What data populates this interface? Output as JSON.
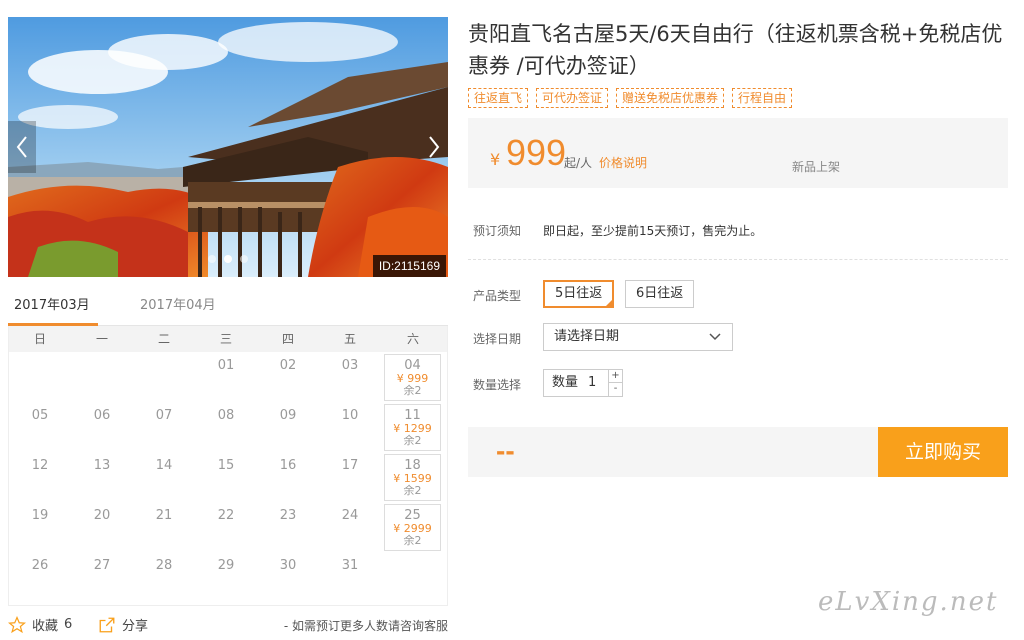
{
  "gallery": {
    "image_id": "ID:2115169",
    "dots": 3,
    "active_dot": 2,
    "image_alt": "Kiyomizu temple wooden stage among red autumn leaves"
  },
  "calendar": {
    "months": [
      "2017年03月",
      "2017年04月"
    ],
    "active_month": 0,
    "weekdays": [
      "日",
      "一",
      "二",
      "三",
      "四",
      "五",
      "六"
    ],
    "weeks": [
      [
        {
          "d": ""
        },
        {
          "d": ""
        },
        {
          "d": ""
        },
        {
          "d": "01"
        },
        {
          "d": "02"
        },
        {
          "d": "03"
        },
        {
          "d": "04",
          "price": "¥ 999",
          "stock": "余2"
        }
      ],
      [
        {
          "d": "05"
        },
        {
          "d": "06"
        },
        {
          "d": "07"
        },
        {
          "d": "08"
        },
        {
          "d": "09"
        },
        {
          "d": "10"
        },
        {
          "d": "11",
          "price": "¥ 1299",
          "stock": "余2"
        }
      ],
      [
        {
          "d": "12"
        },
        {
          "d": "13"
        },
        {
          "d": "14"
        },
        {
          "d": "15"
        },
        {
          "d": "16"
        },
        {
          "d": "17"
        },
        {
          "d": "18",
          "price": "¥ 1599",
          "stock": "余2"
        }
      ],
      [
        {
          "d": "19"
        },
        {
          "d": "20"
        },
        {
          "d": "21"
        },
        {
          "d": "22"
        },
        {
          "d": "23"
        },
        {
          "d": "24"
        },
        {
          "d": "25",
          "price": "¥ 2999",
          "stock": "余2"
        }
      ],
      [
        {
          "d": "26"
        },
        {
          "d": "27"
        },
        {
          "d": "28"
        },
        {
          "d": "29"
        },
        {
          "d": "30"
        },
        {
          "d": "31"
        },
        {
          "d": ""
        }
      ]
    ]
  },
  "bottom": {
    "favorite_label": "收藏",
    "favorite_count": "6",
    "share_label": "分享",
    "consult": "- 如需预订更多人数请咨询客服"
  },
  "product": {
    "title": "贵阳直飞名古屋5天/6天自由行（往返机票含税+免税店优惠券 /可代办签证）",
    "tags": [
      "往返直飞",
      "可代办签证",
      "赠送免税店优惠券",
      "行程自由"
    ],
    "currency": "¥",
    "price": "999",
    "price_unit": "起/人",
    "price_note": "价格说明",
    "new_tag": "新品上架",
    "notice_label": "预订须知",
    "notice_text": "即日起，至少提前15天预订，售完为止。",
    "type_label": "产品类型",
    "types": [
      "5日往返",
      "6日往返"
    ],
    "selected_type": 0,
    "date_label": "选择日期",
    "date_placeholder": "请选择日期",
    "qty_label_row": "数量选择",
    "qty_label": "数量",
    "qty_value": "1",
    "qty_plus": "+",
    "qty_minus": "-",
    "total": "--",
    "buy_label": "立即购买"
  },
  "watermark": "eLvXing.net",
  "colors": {
    "accent": "#f08c2e",
    "buy_button": "#f9a01b",
    "panel_bg": "#f5f5f5"
  }
}
